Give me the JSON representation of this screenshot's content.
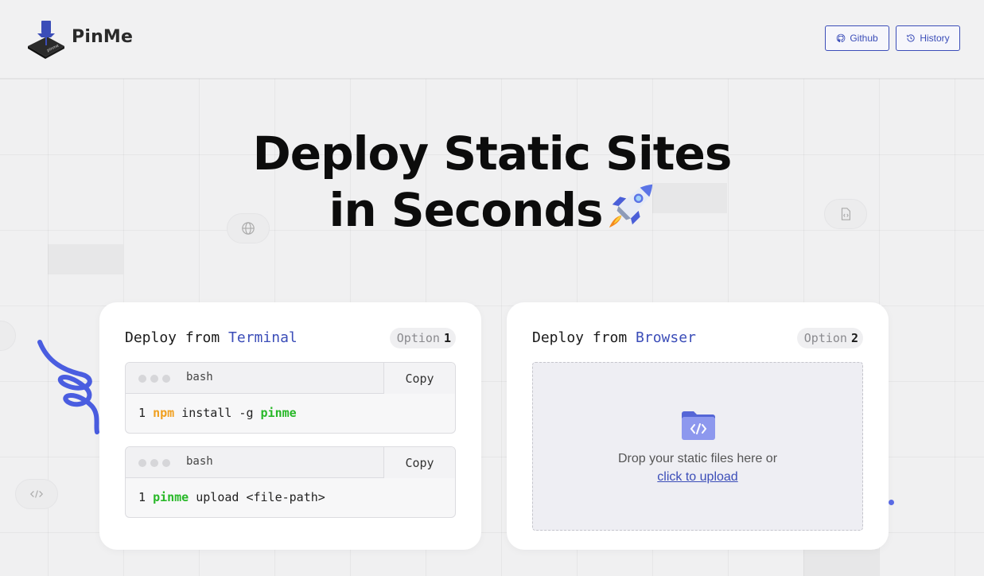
{
  "header": {
    "brand": "PinMe",
    "github_label": "Github",
    "history_label": "History"
  },
  "hero": {
    "line1": "Deploy Static Sites",
    "line2": "in Seconds"
  },
  "terminal_card": {
    "title_prefix": "Deploy from ",
    "title_accent": "Terminal",
    "option_label": "Option",
    "option_number": "1",
    "blocks": [
      {
        "shell": "bash",
        "copy_label": "Copy",
        "line_number": "1",
        "tokens": [
          "npm",
          " install -g ",
          "pinme"
        ]
      },
      {
        "shell": "bash",
        "copy_label": "Copy",
        "line_number": "1",
        "tokens": [
          "pinme",
          " upload <file-path>"
        ]
      }
    ]
  },
  "browser_card": {
    "title_prefix": "Deploy from ",
    "title_accent": "Browser",
    "option_label": "Option",
    "option_number": "2",
    "drop_text": "Drop your static files here or",
    "upload_link": "click to upload"
  },
  "colors": {
    "accent": "#3b4db8",
    "npm_token": "#f0a020",
    "pinme_token": "#28b828"
  }
}
